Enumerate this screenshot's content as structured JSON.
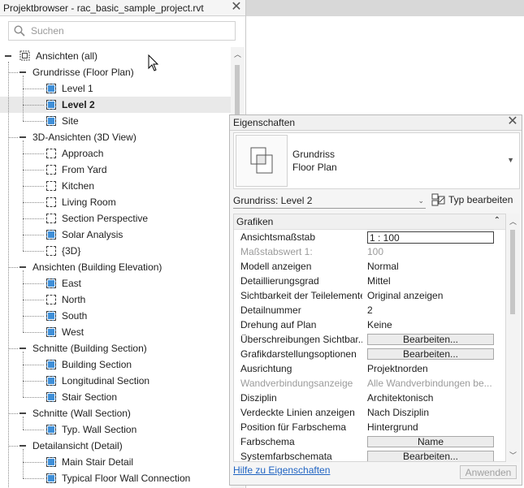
{
  "project_browser": {
    "title": "Projektbrowser - rac_basic_sample_project.rvt",
    "search_placeholder": "Suchen",
    "tree": [
      {
        "label": "Ansichten (all)",
        "level": 0,
        "kind": "root"
      },
      {
        "label": "Grundrisse (Floor Plan)",
        "level": 1,
        "kind": "group"
      },
      {
        "label": "Level 1",
        "level": 2,
        "kind": "view-blue"
      },
      {
        "label": "Level 2",
        "level": 2,
        "kind": "view-blue",
        "selected": true
      },
      {
        "label": "Site",
        "level": 2,
        "kind": "view-blue"
      },
      {
        "label": "3D-Ansichten (3D View)",
        "level": 1,
        "kind": "group"
      },
      {
        "label": "Approach",
        "level": 2,
        "kind": "view-white"
      },
      {
        "label": "From Yard",
        "level": 2,
        "kind": "view-white"
      },
      {
        "label": "Kitchen",
        "level": 2,
        "kind": "view-white"
      },
      {
        "label": "Living Room",
        "level": 2,
        "kind": "view-white"
      },
      {
        "label": "Section Perspective",
        "level": 2,
        "kind": "view-white"
      },
      {
        "label": "Solar Analysis",
        "level": 2,
        "kind": "view-blue"
      },
      {
        "label": "{3D}",
        "level": 2,
        "kind": "view-white"
      },
      {
        "label": "Ansichten (Building Elevation)",
        "level": 1,
        "kind": "group"
      },
      {
        "label": "East",
        "level": 2,
        "kind": "view-blue"
      },
      {
        "label": "North",
        "level": 2,
        "kind": "view-white"
      },
      {
        "label": "South",
        "level": 2,
        "kind": "view-blue"
      },
      {
        "label": "West",
        "level": 2,
        "kind": "view-blue"
      },
      {
        "label": "Schnitte (Building Section)",
        "level": 1,
        "kind": "group"
      },
      {
        "label": "Building Section",
        "level": 2,
        "kind": "view-blue"
      },
      {
        "label": "Longitudinal Section",
        "level": 2,
        "kind": "view-blue"
      },
      {
        "label": "Stair Section",
        "level": 2,
        "kind": "view-blue"
      },
      {
        "label": "Schnitte (Wall Section)",
        "level": 1,
        "kind": "group"
      },
      {
        "label": "Typ. Wall Section",
        "level": 2,
        "kind": "view-blue"
      },
      {
        "label": "Detailansicht (Detail)",
        "level": 1,
        "kind": "group"
      },
      {
        "label": "Main Stair Detail",
        "level": 2,
        "kind": "view-blue"
      },
      {
        "label": "Typical Floor Wall Connection",
        "level": 2,
        "kind": "view-blue"
      }
    ]
  },
  "properties": {
    "title": "Eigenschaften",
    "type_name_line1": "Grundriss",
    "type_name_line2": "Floor Plan",
    "instance_selector": "Grundriss: Level 2",
    "edit_type_label": "Typ bearbeiten",
    "section_label": "Grafiken",
    "rows": [
      {
        "name": "Ansichtsmaßstab",
        "value": "1 : 100",
        "style": "box"
      },
      {
        "name": "Maßstabswert 1:",
        "value": "100",
        "style": "disabled"
      },
      {
        "name": "Modell anzeigen",
        "value": "Normal",
        "style": "text"
      },
      {
        "name": "Detaillierungsgrad",
        "value": "Mittel",
        "style": "text"
      },
      {
        "name": "Sichtbarkeit der Teilelemente",
        "value": "Original anzeigen",
        "style": "text"
      },
      {
        "name": "Detailnummer",
        "value": "2",
        "style": "text"
      },
      {
        "name": "Drehung auf Plan",
        "value": "Keine",
        "style": "text"
      },
      {
        "name": "Überschreibungen Sichtbar...",
        "value": "Bearbeiten...",
        "style": "button"
      },
      {
        "name": "Grafikdarstellungsoptionen",
        "value": "Bearbeiten...",
        "style": "button"
      },
      {
        "name": "Ausrichtung",
        "value": "Projektnorden",
        "style": "text"
      },
      {
        "name": "Wandverbindungsanzeige",
        "value": "Alle Wandverbindungen be...",
        "style": "disabled"
      },
      {
        "name": "Disziplin",
        "value": "Architektonisch",
        "style": "text"
      },
      {
        "name": "Verdeckte Linien anzeigen",
        "value": "Nach Disziplin",
        "style": "text"
      },
      {
        "name": "Position für Farbschema",
        "value": "Hintergrund",
        "style": "text"
      },
      {
        "name": "Farbschema",
        "value": "Name",
        "style": "button"
      },
      {
        "name": "Systemfarbschemata",
        "value": "Bearbeiten...",
        "style": "button"
      }
    ],
    "help_link": "Hilfe zu Eigenschaften",
    "apply_label": "Anwenden"
  }
}
